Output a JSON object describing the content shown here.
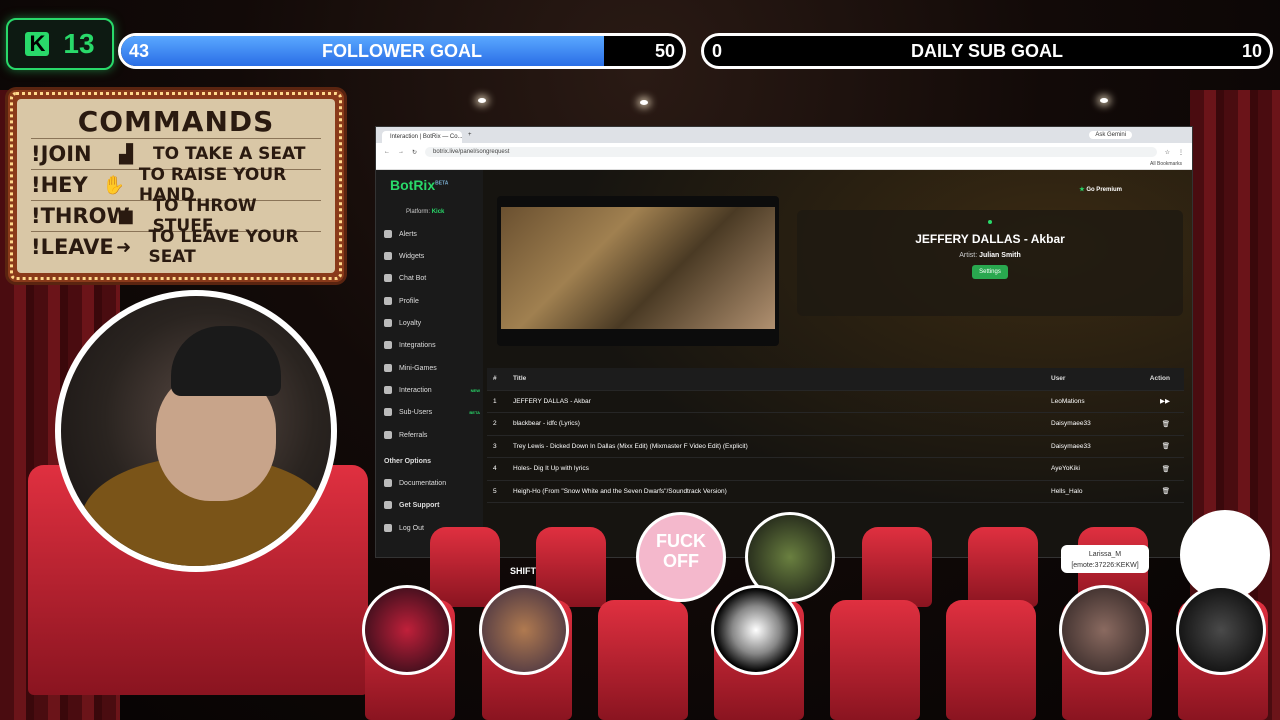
{
  "kick_badge": {
    "letter": "K",
    "count": "13"
  },
  "follower_goal": {
    "current": "43",
    "label": "FOLLOWER GOAL",
    "target": "50",
    "progress": 0.86
  },
  "sub_goal": {
    "current": "0",
    "label": "DAILY SUB GOAL",
    "target": "10",
    "progress": 0
  },
  "commands": {
    "title": "COMMANDS",
    "items": [
      {
        "cmd": "!JOIN",
        "icon": "chair-icon",
        "text": "TO TAKE A SEAT"
      },
      {
        "cmd": "!HEY",
        "icon": "hand-icon",
        "text": "TO RAISE YOUR HAND"
      },
      {
        "cmd": "!THROW",
        "icon": "box-icon",
        "text": "TO THROW STUFF"
      },
      {
        "cmd": "!LEAVE",
        "icon": "exit-chair-icon",
        "text": "TO LEAVE YOUR SEAT"
      }
    ]
  },
  "browser": {
    "tab_title": "Interaction | BotRix — Co...",
    "url": "botrix.live/panel/songrequest",
    "ask_gemini": "Ask Gemini",
    "bookmarks": "All Bookmarks"
  },
  "botrix": {
    "logo": "BotRix",
    "beta": "BETA",
    "platform_label": "Platform:",
    "platform": "Kick",
    "go_premium": "Go Premium",
    "nav": [
      "Alerts",
      "Widgets",
      "Chat Bot",
      "Profile",
      "Loyalty",
      "Integrations",
      "Mini-Games",
      "Interaction",
      "Sub-Users",
      "Referrals"
    ],
    "nav_new": "NEW",
    "nav_beta": "BETA",
    "other_heading": "Other Options",
    "other": [
      "Documentation",
      "Get Support",
      "Log Out"
    ],
    "now_playing": {
      "title": "JEFFERY DALLAS - Akbar",
      "artist_label": "Artist:",
      "artist": "Julian Smith",
      "settings": "Settings"
    },
    "table": {
      "headers": [
        "#",
        "Title",
        "User",
        "Action"
      ],
      "rows": [
        {
          "n": "1",
          "title": "JEFFERY DALLAS - Akbar",
          "user": "LeoMations",
          "action": "▶▶"
        },
        {
          "n": "2",
          "title": "blackbear - idfc (Lyrics)",
          "user": "Daisymaee33",
          "action": "🗑"
        },
        {
          "n": "3",
          "title": "Trey Lewis - Dicked Down In Dallas (Mixx Edit) (Mixmaster F Video Edit) (Explicit)",
          "user": "Daisymaee33",
          "action": "🗑"
        },
        {
          "n": "4",
          "title": "Holes- Dig It Up with lyrics",
          "user": "AyeYoKiki",
          "action": "🗑"
        },
        {
          "n": "5",
          "title": "Heigh-Ho (From \"Snow White and the Seven Dwarfs\"/Soundtrack Version)",
          "user": "Hells_Halo",
          "action": "🗑"
        }
      ]
    }
  },
  "audience": {
    "tooltip_name": "Larissa_M",
    "tooltip_msg": "[emote:37226:KEKW]",
    "shift": "SHIFT",
    "album": "FUCK OFF"
  }
}
